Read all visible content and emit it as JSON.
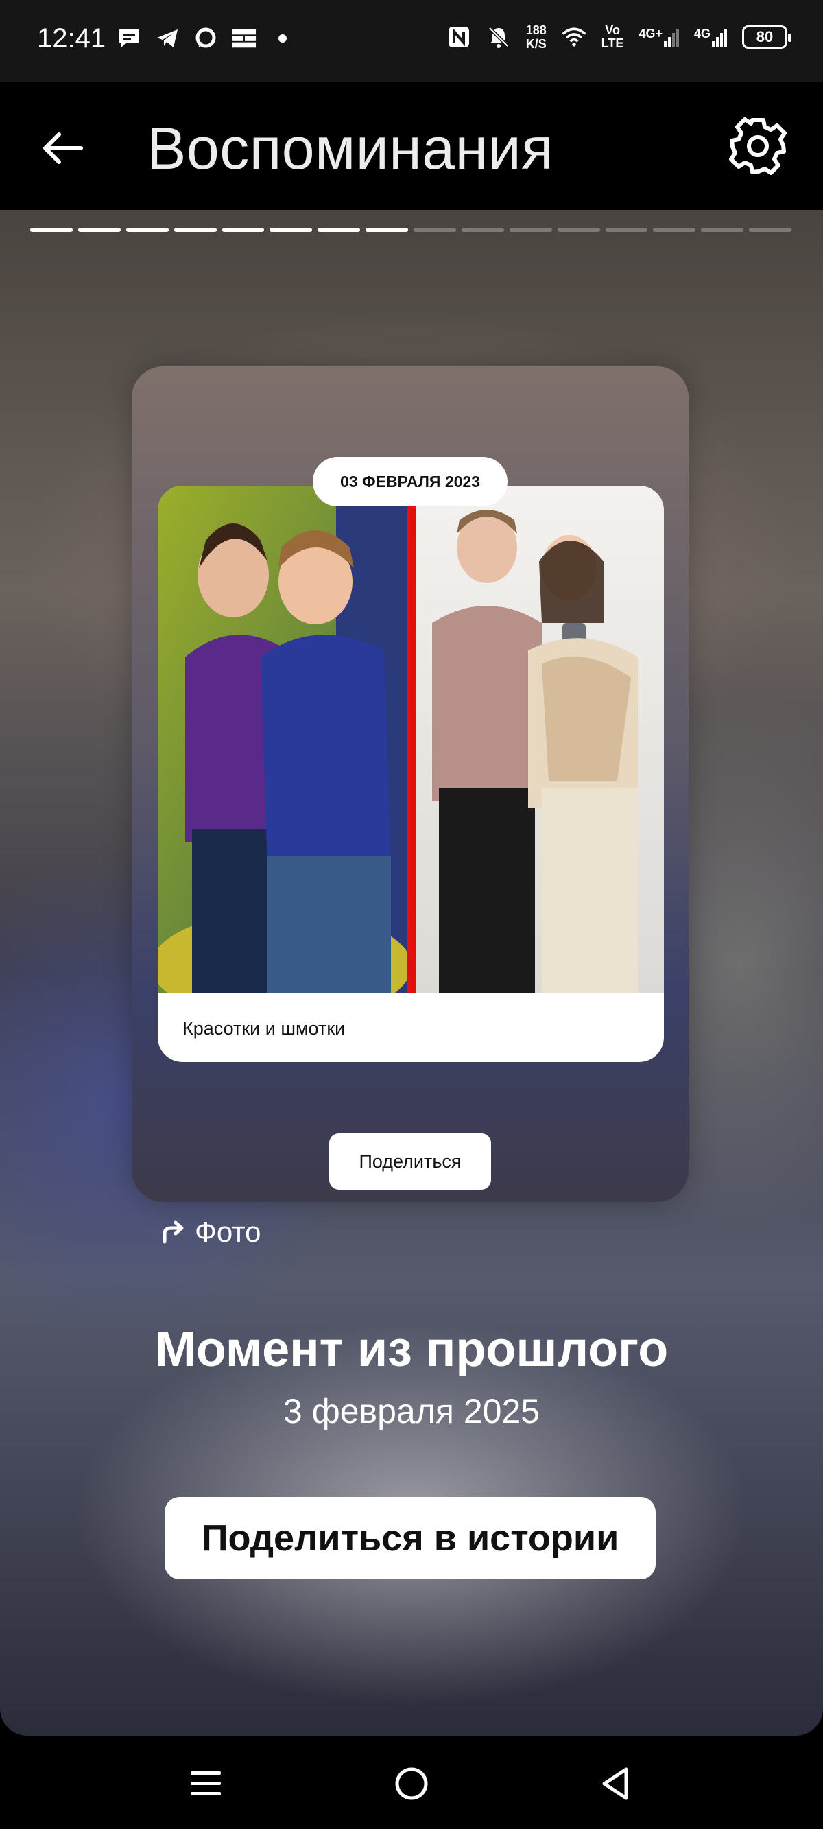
{
  "status_bar": {
    "time": "12:41",
    "left_icons": [
      "message-icon",
      "telegram-icon",
      "chat-bubble-icon",
      "grid-app-icon",
      "dot-icon"
    ],
    "nfc": "nfc-icon",
    "mute": "bell-off-icon",
    "net_speed_value": "188",
    "net_speed_unit": "K/S",
    "volte_top": "Vo",
    "volte_bottom": "LTE",
    "sim1_label": "4G+",
    "sim2_label": "4G",
    "battery": "80"
  },
  "app_bar": {
    "title": "Воспоминания"
  },
  "story": {
    "progress_total": 16,
    "progress_done": 8,
    "card": {
      "date_pill": "03 ФЕВРАЛЯ 2023",
      "caption": "Красотки и шмотки",
      "share_label": "Поделиться"
    },
    "source_label": "Фото",
    "headline": "Момент из прошлого",
    "subhead": "3 февраля 2025",
    "share_story_label": "Поделиться в истории"
  },
  "colors": {
    "status_bar_bg": "#161616",
    "app_bar_bg": "#000000",
    "divider_red": "#e01010"
  }
}
